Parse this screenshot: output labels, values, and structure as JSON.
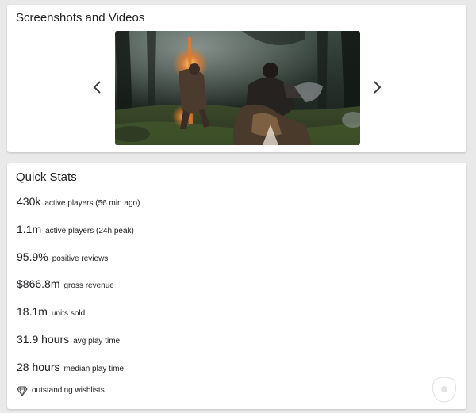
{
  "media": {
    "title": "Screenshots and Videos",
    "prev_icon": "chevron-left-icon",
    "next_icon": "chevron-right-icon"
  },
  "stats": {
    "title": "Quick Stats",
    "rows": [
      {
        "value": "430k",
        "label": "active players (56 min ago)"
      },
      {
        "value": "1.1m",
        "label": "active players (24h peak)"
      },
      {
        "value": "95.9%",
        "label": "positive reviews"
      },
      {
        "value": "$866.8m",
        "label": "gross revenue"
      },
      {
        "value": "18.1m",
        "label": "units sold"
      },
      {
        "value": "31.9 hours",
        "label": "avg play time"
      },
      {
        "value": "28 hours",
        "label": "median play time"
      }
    ],
    "wishlist": {
      "icon": "diamond-icon",
      "label": "outstanding wishlists"
    }
  },
  "colors": {
    "page_background": "#e9e9e9",
    "card_background": "#ffffff",
    "text": "#202124"
  }
}
